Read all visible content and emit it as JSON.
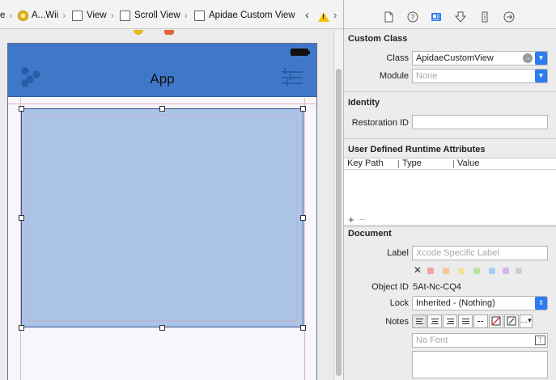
{
  "jumpbar": {
    "crumbs": [
      "e",
      "A...Wii",
      "View",
      "Scroll View",
      "Apidae Custom View"
    ]
  },
  "inspector_tabs": [
    "file-icon",
    "help-icon",
    "identity-icon",
    "attributes-icon",
    "size-icon",
    "connections-icon"
  ],
  "canvas": {
    "nav_title": "App"
  },
  "inspector": {
    "custom_class": {
      "title": "Custom Class",
      "class_label": "Class",
      "class_value": "ApidaeCustomView",
      "module_label": "Module",
      "module_placeholder": "None"
    },
    "identity": {
      "title": "Identity",
      "restoration_label": "Restoration ID",
      "restoration_value": ""
    },
    "udra": {
      "title": "User Defined Runtime Attributes",
      "columns": [
        "Key Path",
        "Type",
        "Value"
      ],
      "add": "+",
      "remove": "−"
    },
    "document": {
      "title": "Document",
      "label_label": "Label",
      "label_placeholder": "Xcode Specific Label",
      "label_colors": [
        "#f2a5a5",
        "#f6c89a",
        "#f3e39a",
        "#b9e4a0",
        "#a6cff3",
        "#d6b3ee",
        "#cfcfcf"
      ],
      "objectid_label": "Object ID",
      "objectid_value": "5At-Nc-CQ4",
      "lock_label": "Lock",
      "lock_value": "Inherited - (Nothing)",
      "notes_label": "Notes",
      "font_placeholder": "No Font"
    }
  }
}
